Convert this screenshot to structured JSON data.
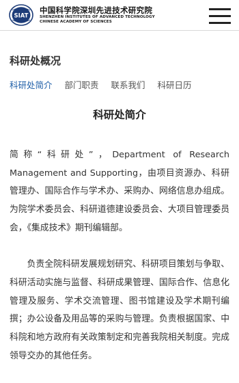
{
  "header": {
    "logo_abbr": "SIAT",
    "org_name_cn": "中国科学院深圳先进技术研究院",
    "org_name_en_line1": "SHENZHEN INSTITUTES OF ADVANCED TECHNOLOGY",
    "org_name_en_line2": "CHINESE ACADEMY OF SCIENCES",
    "menu_icon": "hamburger-menu-icon"
  },
  "section": {
    "title": "科研处概况"
  },
  "tabs": [
    {
      "label": "科研处简介",
      "active": true
    },
    {
      "label": "部门职责",
      "active": false
    },
    {
      "label": "联系我们",
      "active": false
    },
    {
      "label": "科研日历",
      "active": false
    }
  ],
  "page": {
    "title": "科研处简介",
    "paragraphs": [
      "简称“科研处”，Department of Research Management and Supporting，由项目资源办、科研管理办、国际合作与学术办、采购办、网络信息办组成。为院学术委员会、科研道德建设委员会、大项目管理委员会，《集成技术》期刊编辑部。",
      "负责全院科研发展规划研究、科研项目策划与争取、科研活动实施与监督、科研成果管理、国际合作、信息化管理及服务、学术交流管理、图书馆建设及学术期刊编撰；办公设备及用品等的采购与管理。负责根据国家、中科院和地方政府有关政策制定和完善我院相关制度。完成领导交办的其他任务。"
    ]
  },
  "colors": {
    "accent_blue": "#1f5fa8",
    "logo_navy": "#1d3c78",
    "text": "#333333"
  }
}
